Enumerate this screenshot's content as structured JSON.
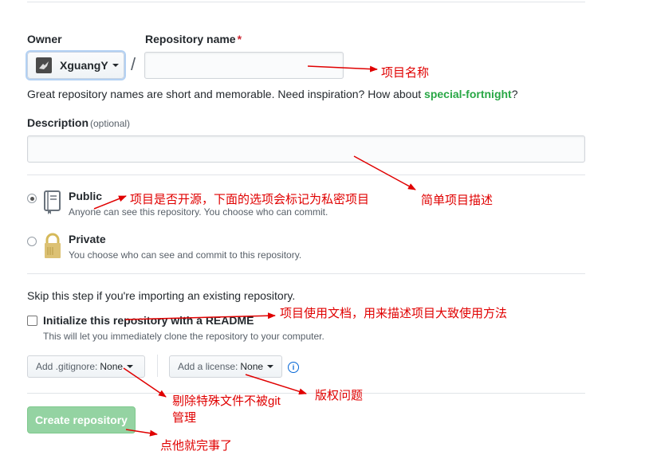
{
  "owner": {
    "label": "Owner",
    "value": "XguangY"
  },
  "repo_name": {
    "label": "Repository name",
    "required_mark": "*",
    "value": ""
  },
  "separator": "/",
  "name_hint": {
    "text": "Great repository names are short and memorable. Need inspiration? How about ",
    "suggestion": "special-fortnight",
    "end": "?"
  },
  "description": {
    "label": "Description",
    "optional": "(optional)",
    "value": ""
  },
  "visibility": {
    "public": {
      "title": "Public",
      "desc": "Anyone can see this repository. You choose who can commit.",
      "selected": true
    },
    "private": {
      "title": "Private",
      "desc": "You choose who can see and commit to this repository.",
      "selected": false
    }
  },
  "import_note": "Skip this step if you're importing an existing repository.",
  "readme": {
    "label": "Initialize this repository with a README",
    "desc": "This will let you immediately clone the repository to your computer.",
    "checked": false
  },
  "gitignore": {
    "label": "Add .gitignore:",
    "value": "None"
  },
  "license": {
    "label": "Add a license:",
    "value": "None"
  },
  "create_button": "Create repository",
  "annotations": {
    "name": "项目名称",
    "public": "项目是否开源，下面的选项会标记为私密项目",
    "description": "简单项目描述",
    "readme": "项目使用文档，用来描述项目大致使用方法",
    "gitignore_line1": "剔除特殊文件不被git",
    "gitignore_line2": "管理",
    "license": "版权问题",
    "create": "点他就完事了"
  },
  "colors": {
    "accent_green": "#28a745",
    "annotation_red": "#e00000",
    "create_button_bg": "#94d3a2"
  }
}
